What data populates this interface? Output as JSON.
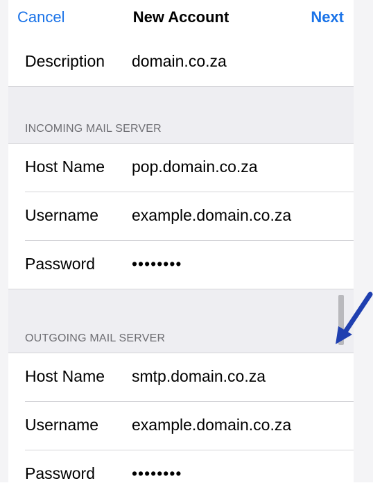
{
  "nav": {
    "cancel": "Cancel",
    "title": "New Account",
    "next": "Next"
  },
  "description": {
    "label": "Description",
    "value": "domain.co.za"
  },
  "incoming": {
    "header": "INCOMING MAIL SERVER",
    "host": {
      "label": "Host Name",
      "value": "pop.domain.co.za"
    },
    "username": {
      "label": "Username",
      "value": "example.domain.co.za"
    },
    "password": {
      "label": "Password",
      "value": "••••••••"
    }
  },
  "outgoing": {
    "header": "OUTGOING MAIL SERVER",
    "host": {
      "label": "Host Name",
      "value": "smtp.domain.co.za"
    },
    "username": {
      "label": "Username",
      "value": "example.domain.co.za"
    },
    "password": {
      "label": "Password",
      "value": "••••••••"
    }
  },
  "colors": {
    "accent": "#1a73e8",
    "group_bg": "#eeeef2",
    "arrow": "#1f3fb0"
  }
}
